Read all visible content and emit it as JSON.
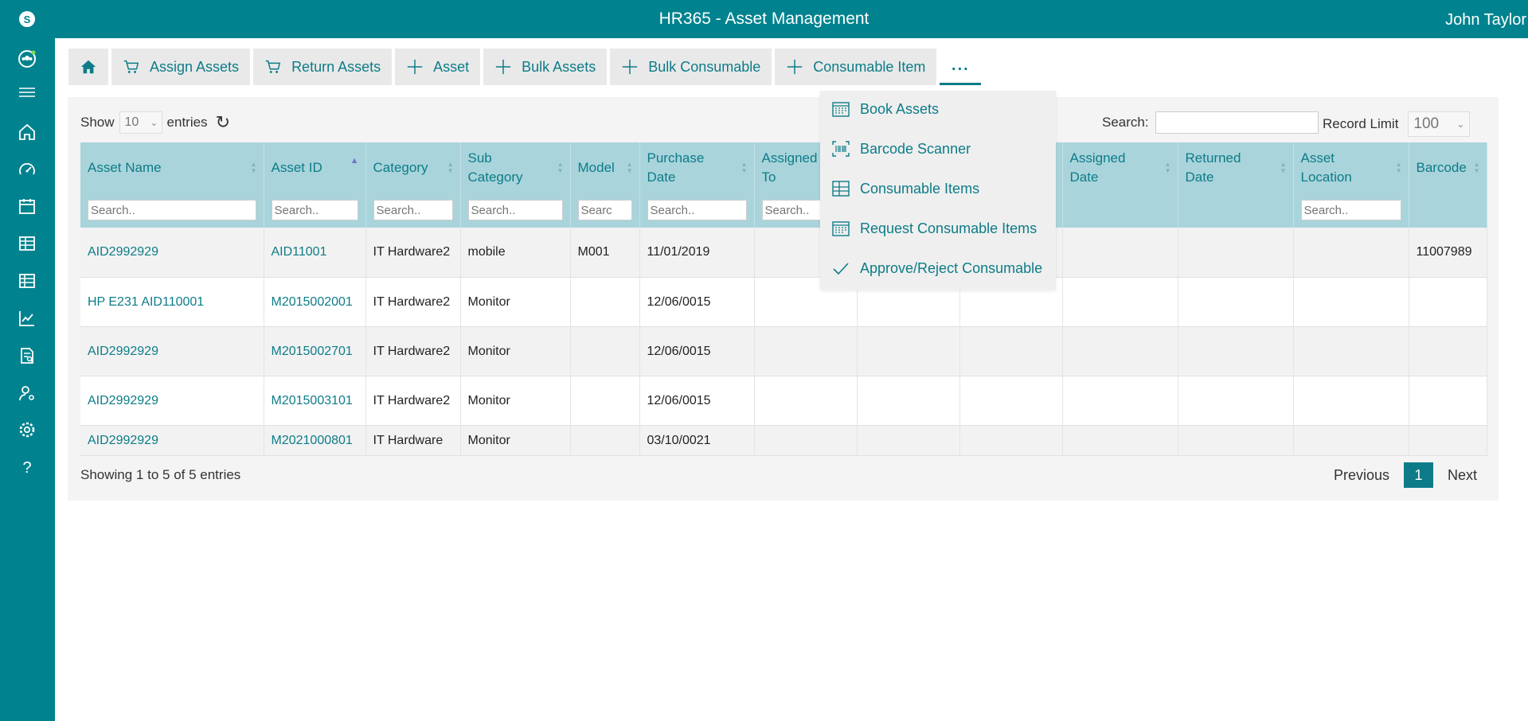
{
  "app": {
    "title": "HR365 - Asset Management",
    "user": "John Taylor"
  },
  "sidebar": {
    "icons": [
      "app-logo-icon",
      "team-icon",
      "menu-icon",
      "home-icon",
      "dashboard-icon",
      "calendar-icon",
      "table-icon",
      "list-icon",
      "chart-icon",
      "report-icon",
      "user-settings-icon",
      "settings-icon",
      "help-icon"
    ]
  },
  "toolbar": {
    "assign_assets": "Assign Assets",
    "return_assets": "Return Assets",
    "asset": "Asset",
    "bulk_assets": "Bulk Assets",
    "bulk_consumable": "Bulk Consumable",
    "consumable_item": "Consumable Item",
    "more": "..."
  },
  "dropdown": {
    "items": [
      "Book Assets",
      "Barcode Scanner",
      "Consumable Items",
      "Request Consumable Items",
      "Approve/Reject Consumable"
    ]
  },
  "controls": {
    "show_label": "Show",
    "entries_value": "10",
    "entries_label": "entries",
    "search_label": "Search:",
    "record_limit_label": "Record Limit",
    "record_limit_value": "100"
  },
  "table": {
    "columns": [
      "Asset Name",
      "Asset ID",
      "Category",
      "Sub Category",
      "Model",
      "Purchase Date",
      "Assigned To",
      "",
      "",
      "Assigned Date",
      "Returned Date",
      "Asset Location",
      "Barcode"
    ],
    "filter_placeholder": "Search..",
    "model_placeholder": "Searc",
    "rows": [
      [
        "AID2992929",
        "AID11001",
        "IT Hardware2",
        "mobile",
        "M001",
        "11/01/2019",
        "",
        "",
        "",
        "",
        "",
        "",
        "11007989"
      ],
      [
        "HP E231 AID110001",
        "M2015002001",
        "IT Hardware2",
        "Monitor",
        "",
        "12/06/0015",
        "",
        "",
        "",
        "",
        "",
        "",
        ""
      ],
      [
        "AID2992929",
        "M2015002701",
        "IT Hardware2",
        "Monitor",
        "",
        "12/06/0015",
        "",
        "",
        "",
        "",
        "",
        "",
        ""
      ],
      [
        "AID2992929",
        "M2015003101",
        "IT Hardware2",
        "Monitor",
        "",
        "12/06/0015",
        "",
        "",
        "",
        "",
        "",
        "",
        ""
      ],
      [
        "AID2992929",
        "M2021000801",
        "IT Hardware",
        "Monitor",
        "",
        "03/10/0021",
        "",
        "",
        "",
        "",
        "",
        "",
        ""
      ]
    ]
  },
  "footer": {
    "info": "Showing 1 to 5 of 5 entries",
    "previous": "Previous",
    "page": "1",
    "next": "Next"
  }
}
